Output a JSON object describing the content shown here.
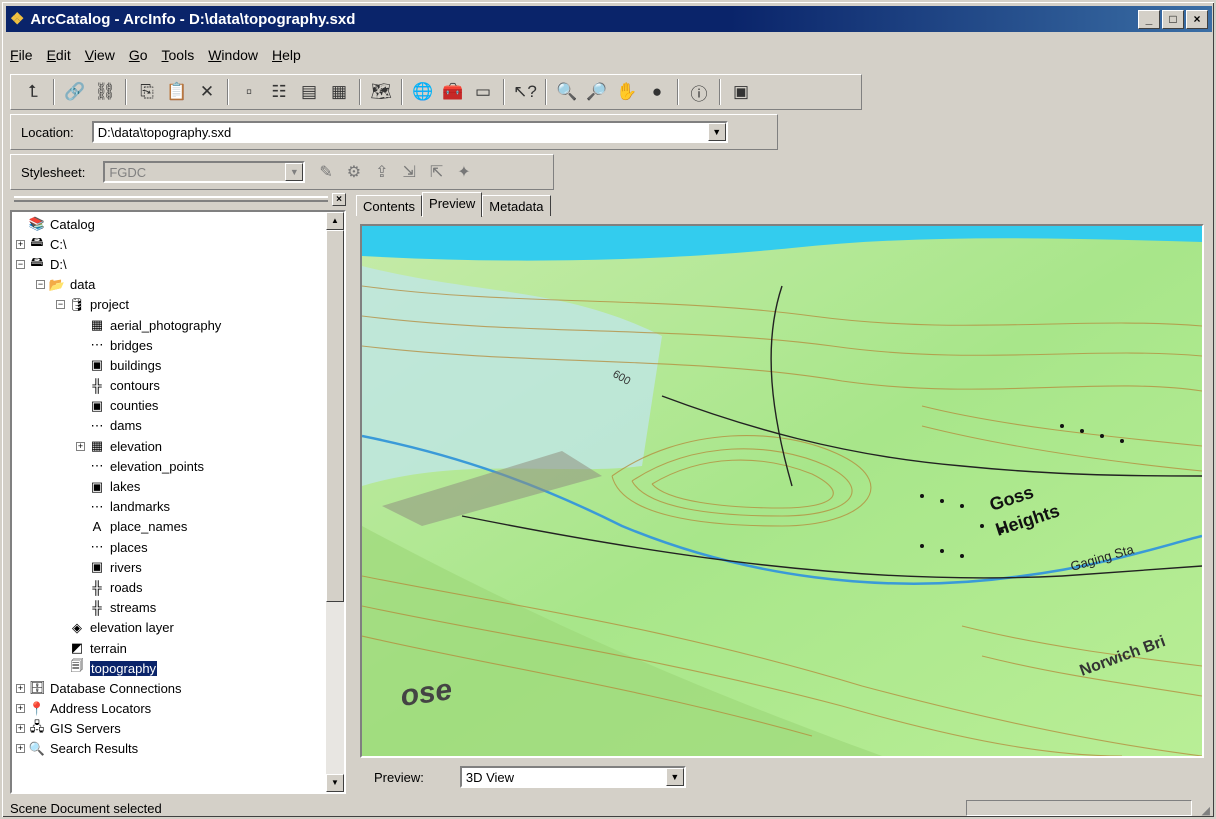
{
  "window": {
    "title": "ArcCatalog - ArcInfo - D:\\data\\topography.sxd",
    "app_icon": "arccatalog-icon",
    "buttons": [
      "_",
      "□",
      "×"
    ]
  },
  "menu": [
    "File",
    "Edit",
    "View",
    "Go",
    "Tools",
    "Window",
    "Help"
  ],
  "toolbar": {
    "groups": [
      [
        {
          "name": "up-one-level-icon",
          "glyph": "⮤"
        }
      ],
      [
        {
          "name": "connect-folder-icon",
          "glyph": "🔗"
        },
        {
          "name": "disconnect-folder-icon",
          "glyph": "⛓"
        }
      ],
      [
        {
          "name": "copy-icon",
          "glyph": "⎘"
        },
        {
          "name": "paste-icon",
          "glyph": "📋"
        },
        {
          "name": "delete-icon",
          "glyph": "✕"
        }
      ],
      [
        {
          "name": "large-icons-icon",
          "glyph": "▫"
        },
        {
          "name": "list-icon",
          "glyph": "☷"
        },
        {
          "name": "details-icon",
          "glyph": "▤"
        },
        {
          "name": "thumbnails-icon",
          "glyph": "▦"
        }
      ],
      [
        {
          "name": "launch-arcmap-icon",
          "glyph": "🗺"
        }
      ],
      [
        {
          "name": "search-icon",
          "glyph": "🌐"
        },
        {
          "name": "arctoolbox-icon",
          "glyph": "🧰"
        },
        {
          "name": "command-line-icon",
          "glyph": "▭"
        }
      ],
      [
        {
          "name": "whats-this-icon",
          "glyph": "↖?"
        }
      ],
      [
        {
          "name": "zoom-in-icon",
          "glyph": "🔍"
        },
        {
          "name": "zoom-out-icon",
          "glyph": "🔎"
        },
        {
          "name": "pan-icon",
          "glyph": "✋"
        },
        {
          "name": "full-extent-icon",
          "glyph": "●"
        }
      ],
      [
        {
          "name": "identify-icon",
          "glyph": "ⓘ"
        }
      ],
      [
        {
          "name": "generate-thumbnail-icon",
          "glyph": "▣"
        }
      ]
    ]
  },
  "location": {
    "label": "Location:",
    "value": "D:\\data\\topography.sxd"
  },
  "stylesheet": {
    "label": "Stylesheet:",
    "value": "FGDC"
  },
  "tree": [
    {
      "level": 0,
      "expander": "",
      "icon": "catalog-icon",
      "glyph": "📚",
      "label": "Catalog"
    },
    {
      "level": 0,
      "expander": "+",
      "icon": "drive-icon",
      "glyph": "🖴",
      "label": "C:\\"
    },
    {
      "level": 0,
      "expander": "−",
      "icon": "drive-icon",
      "glyph": "🖴",
      "label": "D:\\"
    },
    {
      "level": 1,
      "expander": "−",
      "icon": "folder-open-icon",
      "glyph": "📂",
      "label": "data"
    },
    {
      "level": 2,
      "expander": "−",
      "icon": "geodatabase-icon",
      "glyph": "🛢",
      "label": "project"
    },
    {
      "level": 3,
      "expander": "",
      "icon": "raster-icon",
      "glyph": "▦",
      "label": "aerial_photography"
    },
    {
      "level": 3,
      "expander": "",
      "icon": "point-feature-icon",
      "glyph": "⋯",
      "label": "bridges"
    },
    {
      "level": 3,
      "expander": "",
      "icon": "polygon-feature-icon",
      "glyph": "▣",
      "label": "buildings"
    },
    {
      "level": 3,
      "expander": "",
      "icon": "line-feature-icon",
      "glyph": "╬",
      "label": "contours"
    },
    {
      "level": 3,
      "expander": "",
      "icon": "polygon-feature-icon",
      "glyph": "▣",
      "label": "counties"
    },
    {
      "level": 3,
      "expander": "",
      "icon": "point-feature-icon",
      "glyph": "⋯",
      "label": "dams"
    },
    {
      "level": 3,
      "expander": "+",
      "icon": "raster-icon",
      "glyph": "▦",
      "label": "elevation"
    },
    {
      "level": 3,
      "expander": "",
      "icon": "point-feature-icon",
      "glyph": "⋯",
      "label": "elevation_points"
    },
    {
      "level": 3,
      "expander": "",
      "icon": "polygon-feature-icon",
      "glyph": "▣",
      "label": "lakes"
    },
    {
      "level": 3,
      "expander": "",
      "icon": "point-feature-icon",
      "glyph": "⋯",
      "label": "landmarks"
    },
    {
      "level": 3,
      "expander": "",
      "icon": "annotation-feature-icon",
      "glyph": "A",
      "label": "place_names"
    },
    {
      "level": 3,
      "expander": "",
      "icon": "point-feature-icon",
      "glyph": "⋯",
      "label": "places"
    },
    {
      "level": 3,
      "expander": "",
      "icon": "polygon-feature-icon",
      "glyph": "▣",
      "label": "rivers"
    },
    {
      "level": 3,
      "expander": "",
      "icon": "line-feature-icon",
      "glyph": "╬",
      "label": "roads"
    },
    {
      "level": 3,
      "expander": "",
      "icon": "line-feature-icon",
      "glyph": "╬",
      "label": "streams"
    },
    {
      "level": 2,
      "expander": "",
      "icon": "layer-icon",
      "glyph": "◈",
      "label": "elevation layer"
    },
    {
      "level": 2,
      "expander": "",
      "icon": "tin-icon",
      "glyph": "◩",
      "label": "terrain"
    },
    {
      "level": 2,
      "expander": "",
      "icon": "scene-document-icon",
      "glyph": "🗐",
      "label": "topography",
      "selected": true
    },
    {
      "level": 0,
      "expander": "+",
      "icon": "database-connections-icon",
      "glyph": "🗄",
      "label": "Database Connections"
    },
    {
      "level": 0,
      "expander": "+",
      "icon": "address-locators-icon",
      "glyph": "📍",
      "label": "Address Locators"
    },
    {
      "level": 0,
      "expander": "+",
      "icon": "gis-servers-icon",
      "glyph": "🖧",
      "label": "GIS Servers"
    },
    {
      "level": 0,
      "expander": "+",
      "icon": "search-results-icon",
      "glyph": "🔍",
      "label": "Search Results"
    }
  ],
  "tabs": [
    "Contents",
    "Preview",
    "Metadata"
  ],
  "active_tab": "Preview",
  "preview": {
    "label": "Preview:",
    "value": "3D View",
    "map_labels": [
      "Goss",
      "Heights",
      "Gaging Sta",
      "Norwich Bri",
      "ose",
      "600"
    ]
  },
  "status": {
    "text": "Scene Document selected"
  },
  "colors": {
    "title_bar": "#0a246a",
    "chrome": "#d4d0c8",
    "selection": "#0a246a",
    "map_water": "#33ccee",
    "map_land": "#a8e68a"
  }
}
